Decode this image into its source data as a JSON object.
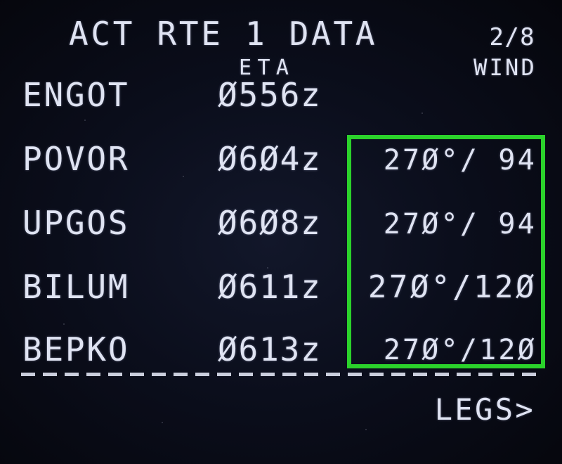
{
  "title": "ACT RTE 1 DATA",
  "page_indicator": "2/8",
  "headers": {
    "eta": "ETA",
    "wind": "WIND"
  },
  "rows": [
    {
      "waypoint": "ENGOT",
      "eta": "Ø556z",
      "wind": ""
    },
    {
      "waypoint": "POVOR",
      "eta": "Ø6Ø4z",
      "wind": "27Ø°/ 94"
    },
    {
      "waypoint": "UPGOS",
      "eta": "Ø6Ø8z",
      "wind": "27Ø°/ 94"
    },
    {
      "waypoint": "BILUM",
      "eta": "Ø611z",
      "wind": "27Ø°/12Ø"
    },
    {
      "waypoint": "BEPKO",
      "eta": "Ø613z",
      "wind": "27Ø°/12Ø"
    }
  ],
  "legs_prompt": "LEGS>",
  "colors": {
    "text": "#dfe3f2",
    "highlight": "#2bd22b",
    "background": "#07080f"
  }
}
